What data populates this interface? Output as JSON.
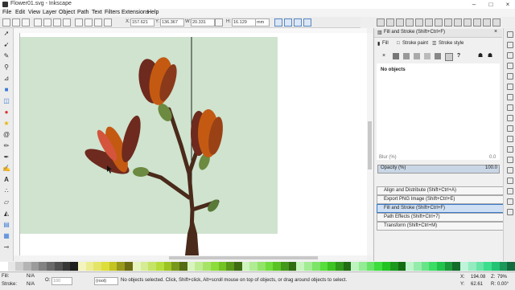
{
  "window": {
    "title": "Flower01.svg - Inkscape"
  },
  "menubar": [
    "File",
    "Edit",
    "View",
    "Layer",
    "Object",
    "Path",
    "Text",
    "Filters",
    "Extensions",
    "Help"
  ],
  "controls": {
    "x_label": "X:",
    "x_value": "157.621",
    "y_label": "Y:",
    "y_value": "136.367",
    "w_label": "W:",
    "w_value": "20.331",
    "h_label": "H:",
    "h_value": "16.129",
    "unit": "mm"
  },
  "dock": {
    "title": "Fill and Stroke (Shift+Ctrl+F)",
    "tabs": [
      "Fill",
      "Stroke paint",
      "Stroke style"
    ],
    "paint_none": "×",
    "paint_unknown": "?",
    "no_objects": "No objects",
    "blur_label": "Blur (%)",
    "blur_value": "0.0",
    "opacity_label": "Opacity (%)",
    "opacity_value": "100.0",
    "collapsed": [
      "Align and Distribute (Shift+Ctrl+A)",
      "Export PNG Image (Shift+Ctrl+E)",
      "Fill and Stroke (Shift+Ctrl+F)",
      "Path Effects  (Shift+Ctrl+7)",
      "Transform (Shift+Ctrl+M)"
    ]
  },
  "status": {
    "fill_label": "Fill:",
    "fill_value": "N/A",
    "stroke_label": "Stroke:",
    "stroke_value": "N/A",
    "opacity_label": "O:",
    "opacity_value": "100",
    "layer": "(root)",
    "message": "No objects selected. Click, Shift+click, Alt+scroll mouse on top of objects, or drag around objects to select.",
    "x_label": "X:",
    "x_value": "194.08",
    "y_label": "Y:",
    "y_value": "62.61",
    "z_label": "Z:",
    "zoom": "79%",
    "r_label": "R:",
    "rotation": "0.00°"
  },
  "colors": {
    "page": "#cfe3cf",
    "petal": "#c45a12",
    "petal_dark": "#6e2a1e",
    "stem": "#4a2a1a",
    "leaf": "#6c8a40"
  },
  "icons": {
    "tools": [
      "selector-icon",
      "node-icon",
      "tweak-icon",
      "zoom-icon",
      "measure-icon",
      "rect-icon",
      "3dbox-icon",
      "ellipse-icon",
      "star-icon",
      "spiral-icon",
      "pencil-icon",
      "pen-icon",
      "calligraphy-icon",
      "text-icon",
      "spray-icon",
      "eraser-icon",
      "bucket-icon",
      "gradient-icon",
      "mesh-icon",
      "dropper-icon"
    ]
  }
}
